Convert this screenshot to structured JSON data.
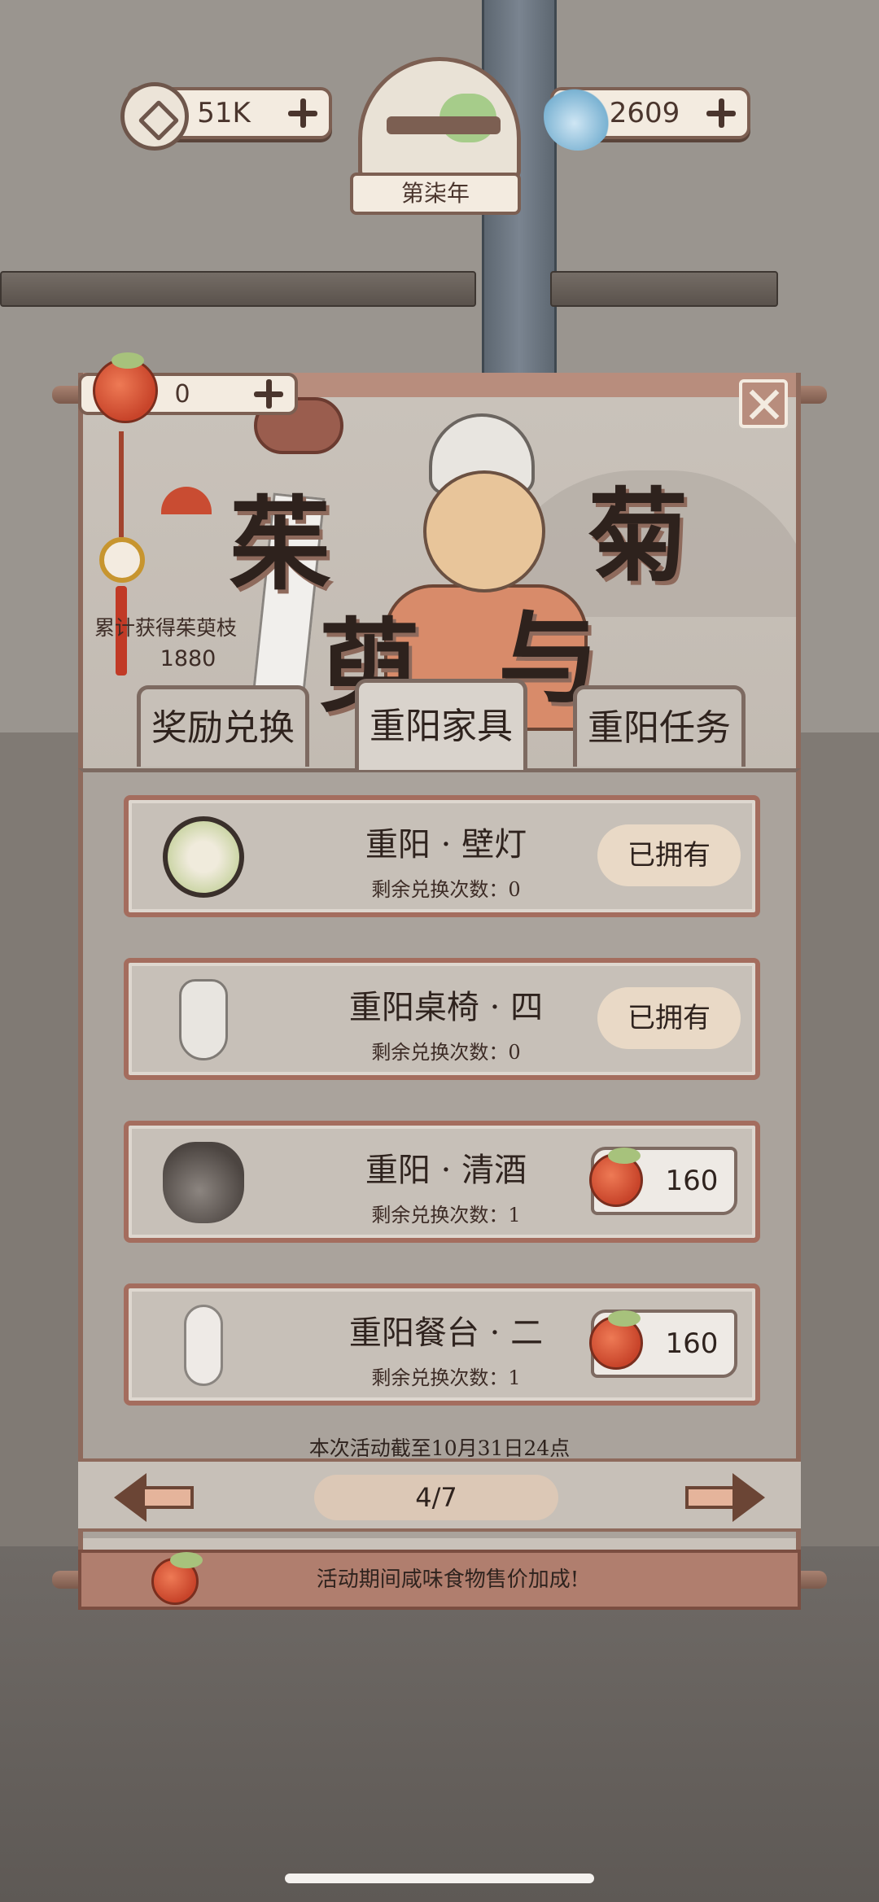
{
  "hud": {
    "coins": "51K",
    "spirit": "2609",
    "year_label": "第柒年"
  },
  "event": {
    "fruit_count": "0",
    "title_chars": [
      "茱",
      "萸",
      "与",
      "菊"
    ],
    "total_label": "累计获得茱萸枝",
    "total_value": "1880"
  },
  "tabs": [
    {
      "label": "奖励兑换"
    },
    {
      "label": "重阳家具"
    },
    {
      "label": "重阳任务"
    }
  ],
  "items": [
    {
      "name": "重阳 · 壁灯",
      "remaining": "剩余兑换次数：0",
      "status": "已拥有",
      "icon": "wall-lamp-icon"
    },
    {
      "name": "重阳桌椅 · 四",
      "remaining": "剩余兑换次数：0",
      "status": "已拥有",
      "icon": "chair-icon"
    },
    {
      "name": "重阳 · 清酒",
      "remaining": "剩余兑换次数：1",
      "price": "160",
      "icon": "wine-jar-icon"
    },
    {
      "name": "重阳餐台 · 二",
      "remaining": "剩余兑换次数：1",
      "price": "160",
      "icon": "table-icon"
    }
  ],
  "deadline": "本次活动截至10月31日24点",
  "pager": {
    "page": "4/7"
  },
  "footer": {
    "text": "活动期间咸味食物售价加成!"
  },
  "colors": {
    "accent": "#a46d5e",
    "fruit": "#c8442a",
    "panel": "#c7c0b8"
  }
}
